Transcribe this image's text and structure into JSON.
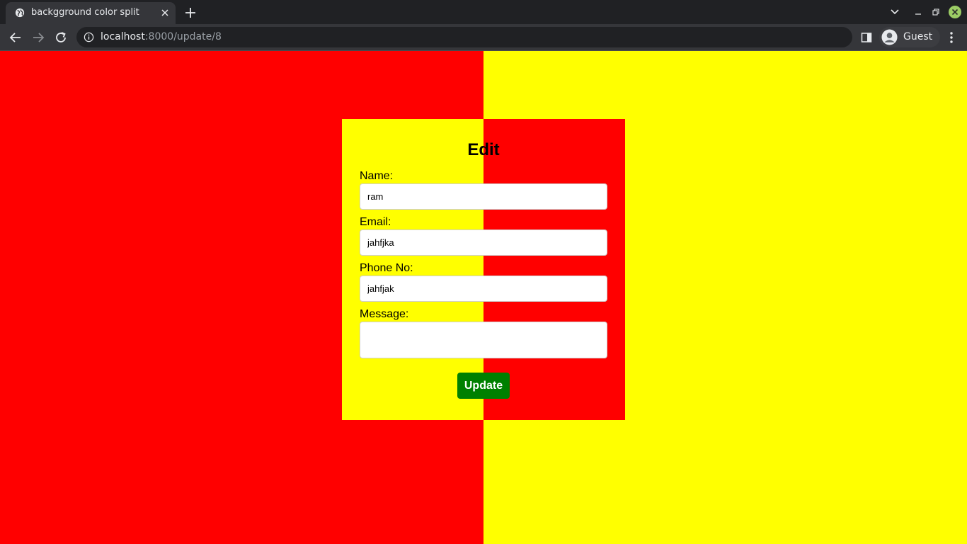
{
  "browser": {
    "tab_title": "backgground color split",
    "url_host": "localhost",
    "url_path": ":8000/update/8",
    "profile_name": "Guest"
  },
  "page": {
    "colors": {
      "red": "#ff0000",
      "yellow": "#ffff00",
      "button": "#008000"
    },
    "form": {
      "title": "Edit",
      "name_label": "Name:",
      "name_value": "ram",
      "email_label": "Email:",
      "email_value": "jahfjka",
      "phone_label": "Phone No:",
      "phone_value": "jahfjak",
      "message_label": "Message:",
      "message_value": "",
      "submit_label": "Update"
    }
  },
  "icons": {
    "favicon": "globe-icon",
    "tab_close": "close-icon",
    "new_tab": "plus-icon",
    "tab_search": "chevron-down-icon",
    "minimize": "minimize-icon",
    "restore": "restore-icon",
    "window_close": "close-icon",
    "back": "arrow-left-icon",
    "forward": "arrow-right-icon",
    "reload": "reload-icon",
    "site_info": "info-icon",
    "side_panel": "side-panel-icon",
    "avatar": "person-icon",
    "menu": "more-vert-icon"
  }
}
